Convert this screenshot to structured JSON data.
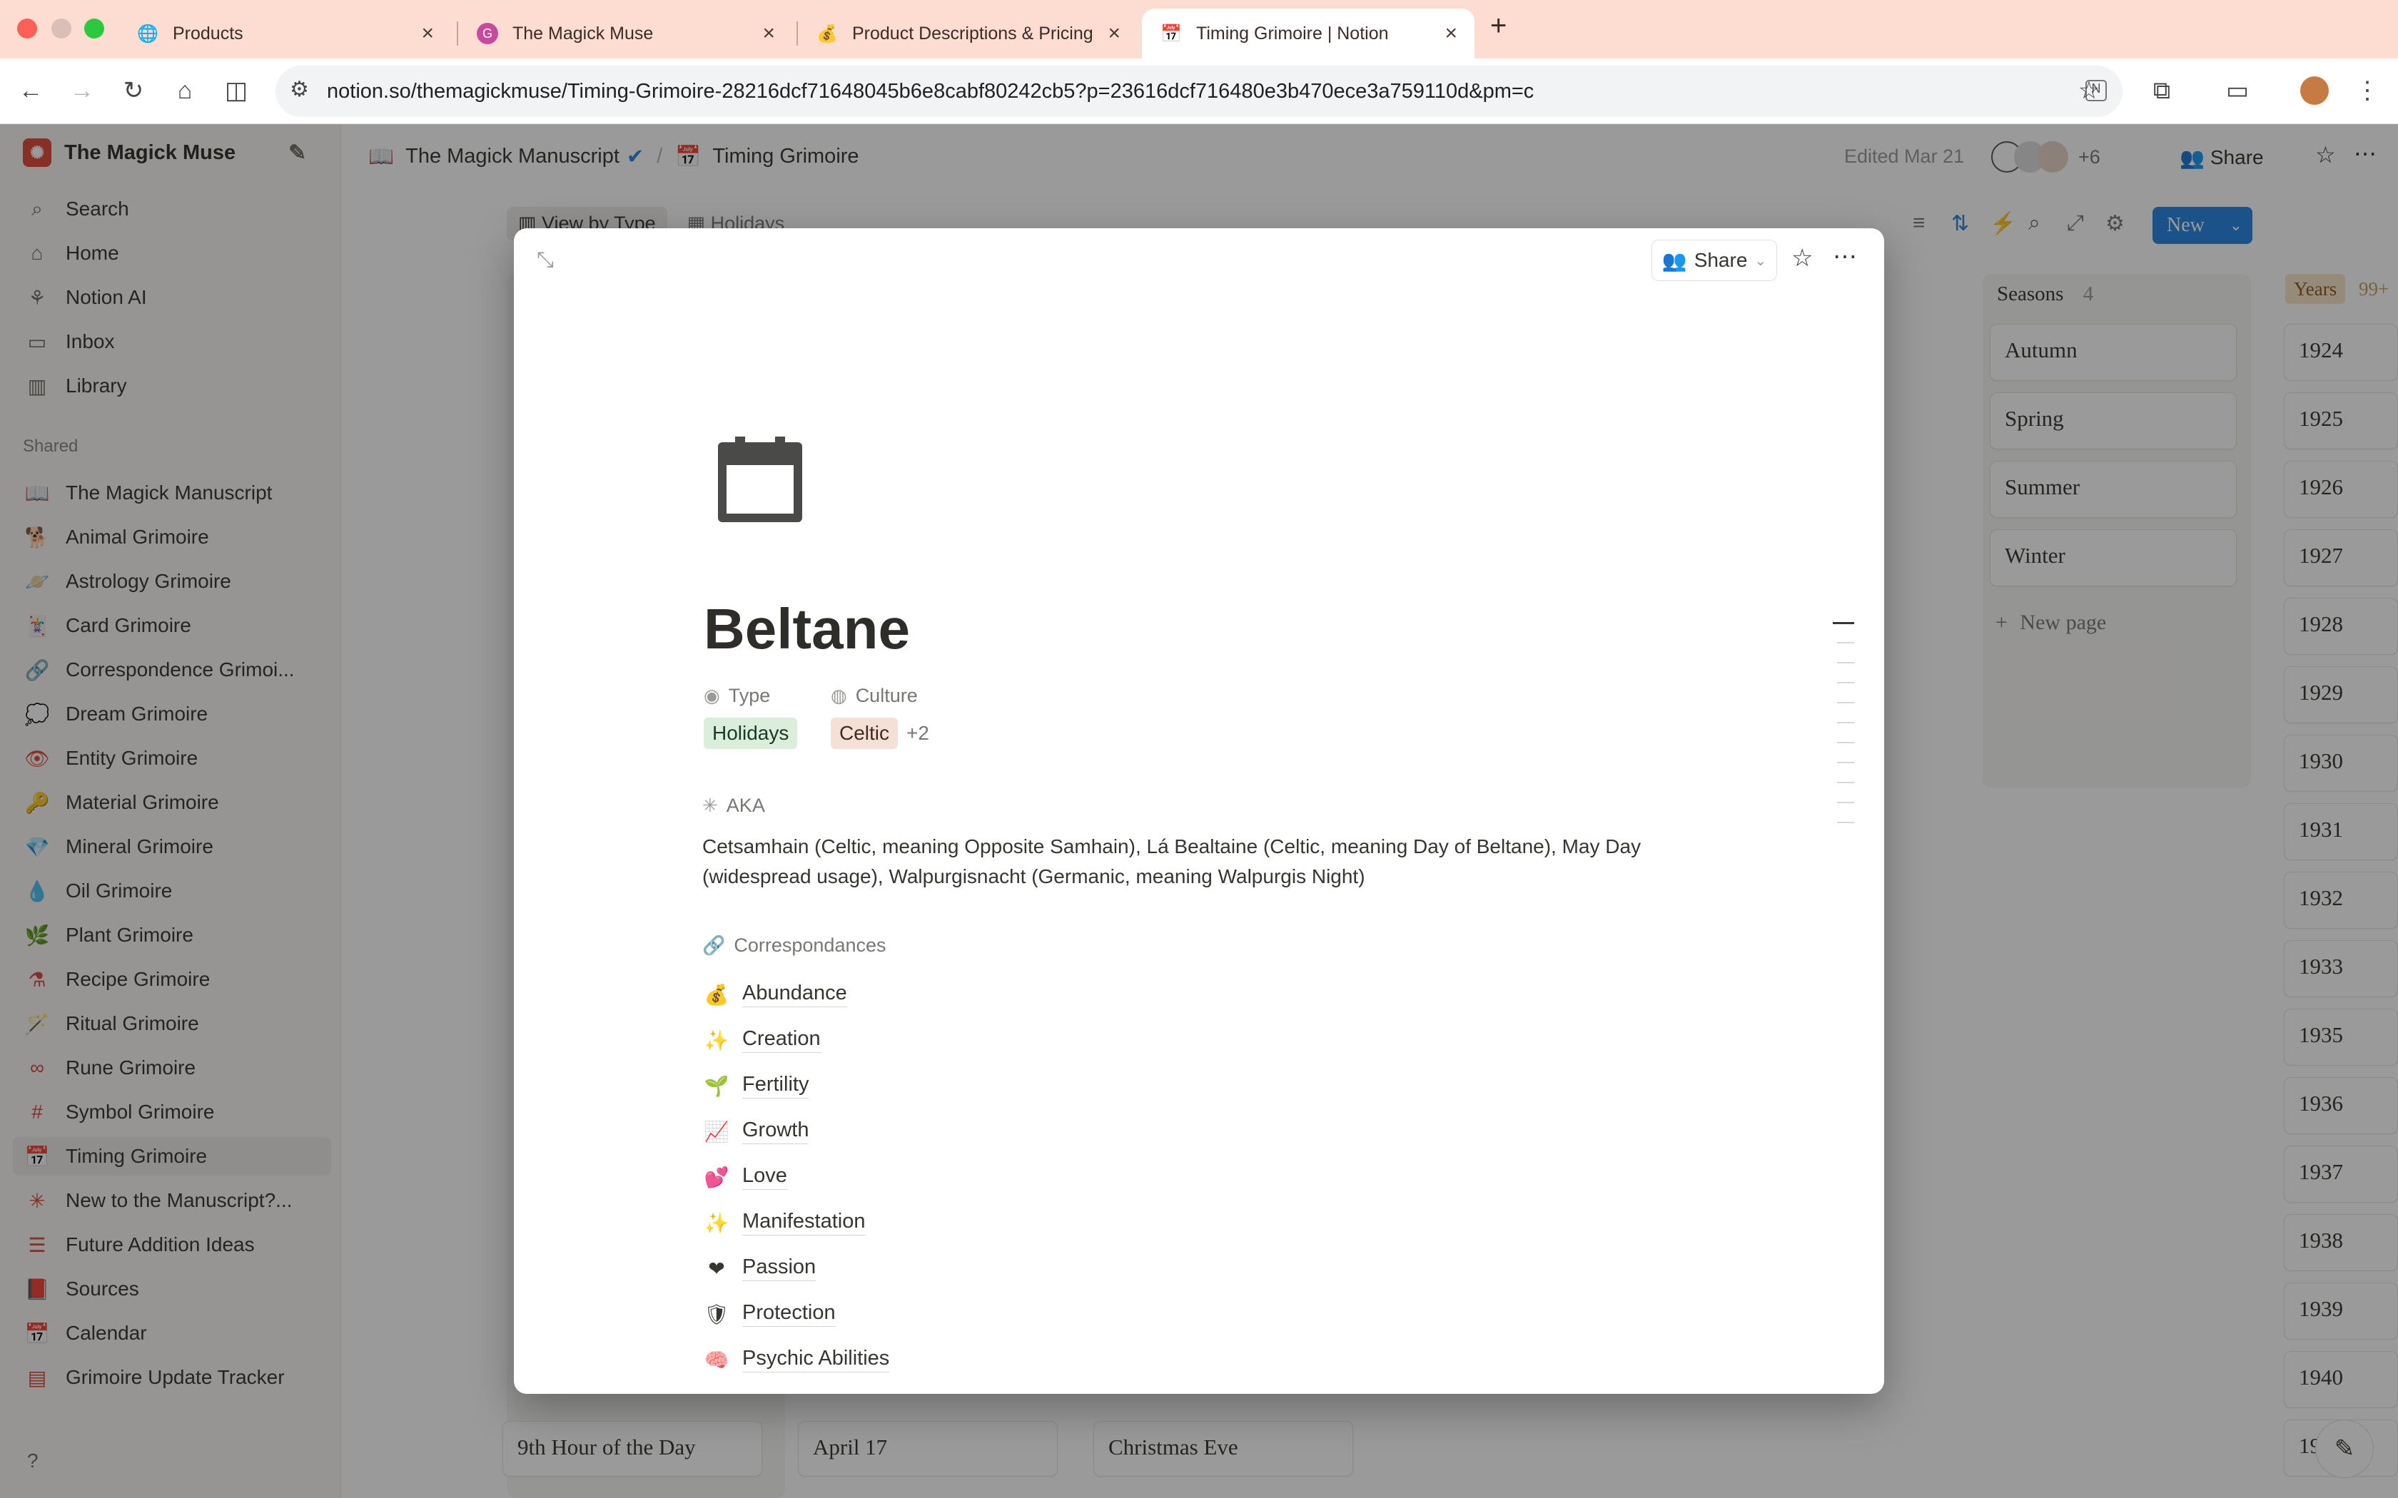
{
  "browser": {
    "tabs": [
      {
        "title": "Products",
        "favicon": "globe-icon"
      },
      {
        "title": "The Magick Muse",
        "favicon": "g-logo-icon"
      },
      {
        "title": "Product Descriptions & Pricing",
        "favicon": "money-bag-icon"
      },
      {
        "title": "Timing Grimoire | Notion",
        "favicon": "calendar-icon",
        "active": true
      }
    ],
    "url": "notion.so/themagickmuse/Timing-Grimoire-28216dcf71648045b6e8cabf80242cb5?p=23616dcf716480e3b470ece3a759110d&pm=c"
  },
  "sidebar": {
    "workspace": "The Magick Muse",
    "nav": [
      "Search",
      "Home",
      "Notion AI",
      "Inbox",
      "Library"
    ],
    "shared_label": "Shared",
    "items": [
      {
        "label": "The Magick Manuscript",
        "icon": "📖"
      },
      {
        "label": "Animal Grimoire",
        "icon": "🐕"
      },
      {
        "label": "Astrology Grimoire",
        "icon": "🪐"
      },
      {
        "label": "Card Grimoire",
        "icon": "🃏"
      },
      {
        "label": "Correspondence Grimoi...",
        "icon": "🔗"
      },
      {
        "label": "Dream Grimoire",
        "icon": "💭"
      },
      {
        "label": "Entity Grimoire",
        "icon": "👁"
      },
      {
        "label": "Material Grimoire",
        "icon": "🔑"
      },
      {
        "label": "Mineral Grimoire",
        "icon": "💎"
      },
      {
        "label": "Oil Grimoire",
        "icon": "💧"
      },
      {
        "label": "Plant Grimoire",
        "icon": "🌿"
      },
      {
        "label": "Recipe Grimoire",
        "icon": "⚗"
      },
      {
        "label": "Ritual Grimoire",
        "icon": "🪄"
      },
      {
        "label": "Rune Grimoire",
        "icon": "∞"
      },
      {
        "label": "Symbol Grimoire",
        "icon": "#"
      },
      {
        "label": "Timing Grimoire",
        "icon": "📅"
      },
      {
        "label": "New to the Manuscript?...",
        "icon": "✳"
      },
      {
        "label": "Future Addition Ideas",
        "icon": "☰"
      },
      {
        "label": "Sources",
        "icon": "📕"
      },
      {
        "label": "Calendar",
        "icon": "📅"
      },
      {
        "label": "Grimoire Update Tracker",
        "icon": "▤"
      }
    ]
  },
  "topbar": {
    "breadcrumb": [
      "The Magick Manuscript",
      "Timing Grimoire"
    ],
    "edited": "Edited Mar 21",
    "avatars_extra": "+6",
    "share": "Share",
    "new_button": "New"
  },
  "board": {
    "views": [
      "View by Type",
      "Holidays"
    ],
    "seasons_header": "Seasons",
    "seasons_count": "4",
    "seasons": [
      "Autumn",
      "Spring",
      "Summer",
      "Winter"
    ],
    "new_page": "New page",
    "years_header": "Years",
    "years_count": "99+",
    "years": [
      "1924",
      "1925",
      "1926",
      "1927",
      "1928",
      "1929",
      "1930",
      "1931",
      "1932",
      "1933",
      "1935",
      "1936",
      "1937",
      "1938",
      "1939",
      "1940",
      "19"
    ],
    "bottom_cards": [
      "9th Hour of the Day",
      "April 17",
      "Christmas Eve"
    ]
  },
  "modal": {
    "share": "Share",
    "title": "Beltane",
    "properties": {
      "type_label": "Type",
      "type_value": "Holidays",
      "culture_label": "Culture",
      "culture_value": "Celtic",
      "culture_more": "+2"
    },
    "aka_label": "AKA",
    "aka_text": "Cetsamhain (Celtic, meaning Opposite Samhain), Lá Bealtaine (Celtic, meaning Day of Beltane), May Day (widespread usage), Walpurgisnacht (Germanic, meaning Walpurgis Night)",
    "correspondences_label": "Correspondances",
    "correspondences": [
      {
        "emoji": "💰",
        "label": "Abundance"
      },
      {
        "emoji": "✨",
        "label": "Creation"
      },
      {
        "emoji": "🌱",
        "label": "Fertility"
      },
      {
        "emoji": "📈",
        "label": "Growth"
      },
      {
        "emoji": "💕",
        "label": "Love"
      },
      {
        "emoji": "✨",
        "label": "Manifestation"
      },
      {
        "emoji": "❤",
        "label": "Passion"
      },
      {
        "emoji": "🛡",
        "label": "Protection"
      },
      {
        "emoji": "🧠",
        "label": "Psychic Abilities"
      }
    ]
  },
  "colors": {
    "tabstrip": "#fddcd2",
    "notion_blue": "#2383e2",
    "holidays_tag": "#dbeddb",
    "celtic_tag": "#f5e0d8"
  }
}
